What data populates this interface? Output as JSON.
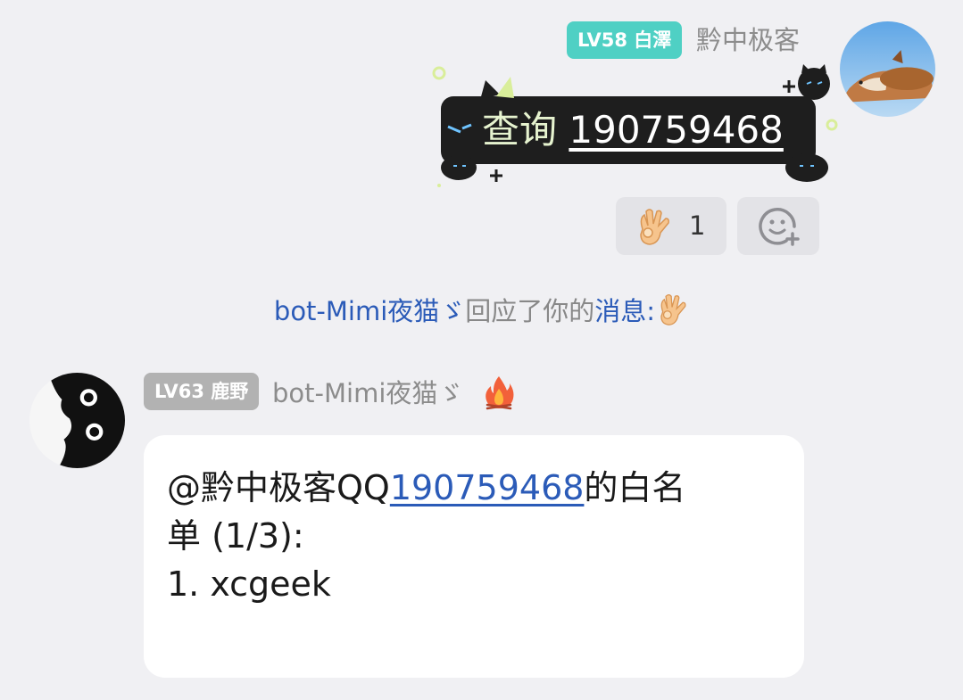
{
  "messages": {
    "outgoing": {
      "level_badge": "LV58 白澤",
      "sender": "黔中极客",
      "command": "查询",
      "number": "190759468",
      "reaction_count": "1"
    },
    "notice": {
      "bot": "bot-Mimi夜猫ゞ",
      "mid": "回应了你的",
      "msg": "消息:"
    },
    "incoming": {
      "level_badge": "LV63 鹿野",
      "sender": "bot-Mimi夜猫ゞ",
      "line1_prefix": "@黔中极客QQ",
      "line1_link": "190759468",
      "line1_suffix": "的白名",
      "line2": "单 (1/3):",
      "line3": "1. xcgeek"
    }
  },
  "icons": [
    "ok-hand-icon",
    "add-reaction-icon",
    "fire-icon"
  ],
  "colors": {
    "badge_teal": "#4fd0c4",
    "badge_gray": "#b2b2b2",
    "link_blue": "#2b5bb8",
    "background": "#f0f0f3"
  }
}
